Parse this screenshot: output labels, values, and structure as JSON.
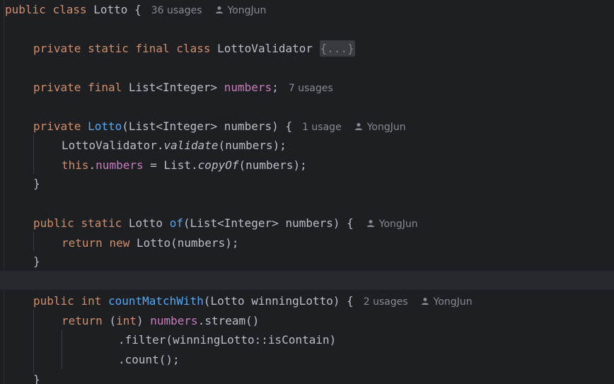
{
  "editor": {
    "lines": {
      "class_decl": {
        "kw_public": "public",
        "kw_class": "class",
        "name": "Lotto",
        "brace": "{",
        "usages": "36 usages",
        "author": "YongJun"
      },
      "validator_decl": {
        "kw_private": "private",
        "kw_static": "static",
        "kw_final": "final",
        "kw_class": "class",
        "name": "LottoValidator",
        "folded": "{...}"
      },
      "field_decl": {
        "kw_private": "private",
        "kw_final": "final",
        "type": "List<Integer>",
        "name": "numbers",
        "semi": ";",
        "usages": "7 usages"
      },
      "ctor_decl": {
        "kw_private": "private",
        "name": "Lotto",
        "params": "(List<Integer> numbers) {",
        "usages": "1 usage",
        "author": "YongJun"
      },
      "ctor_body_1": {
        "target": "LottoValidator.",
        "method": "validate",
        "args": "(numbers);"
      },
      "ctor_body_2": {
        "kw_this": "this",
        "dot": ".",
        "field": "numbers",
        "assign": " = List.",
        "method": "copyOf",
        "args": "(numbers);"
      },
      "ctor_close": {
        "brace": "}"
      },
      "of_decl": {
        "kw_public": "public",
        "kw_static": "static",
        "type": "Lotto",
        "name": "of",
        "params": "(List<Integer> numbers) {",
        "author": "YongJun"
      },
      "of_body": {
        "kw_return": "return",
        "kw_new": "new",
        "expr": "Lotto(numbers);"
      },
      "of_close": {
        "brace": "}"
      },
      "count_decl": {
        "kw_public": "public",
        "kw_int": "int",
        "name": "countMatchWith",
        "params": "(Lotto winningLotto) {",
        "usages": "2 usages",
        "author": "YongJun"
      },
      "count_body_1": {
        "kw_return": "return",
        "cast_open": "(",
        "kw_int": "int",
        "cast_close": ") ",
        "field": "numbers",
        "call": ".stream()"
      },
      "count_body_2": {
        "text": ".filter(winningLotto::isContain)"
      },
      "count_body_3": {
        "text": ".count();"
      },
      "count_close": {
        "brace": "}"
      }
    }
  },
  "icons": {
    "author": "person-icon"
  },
  "colors": {
    "background": "#1e1f22",
    "keyword": "#cf8e6d",
    "method": "#56a8f5",
    "field": "#c77dbb",
    "text": "#bcbec4",
    "hint": "#868a91"
  }
}
